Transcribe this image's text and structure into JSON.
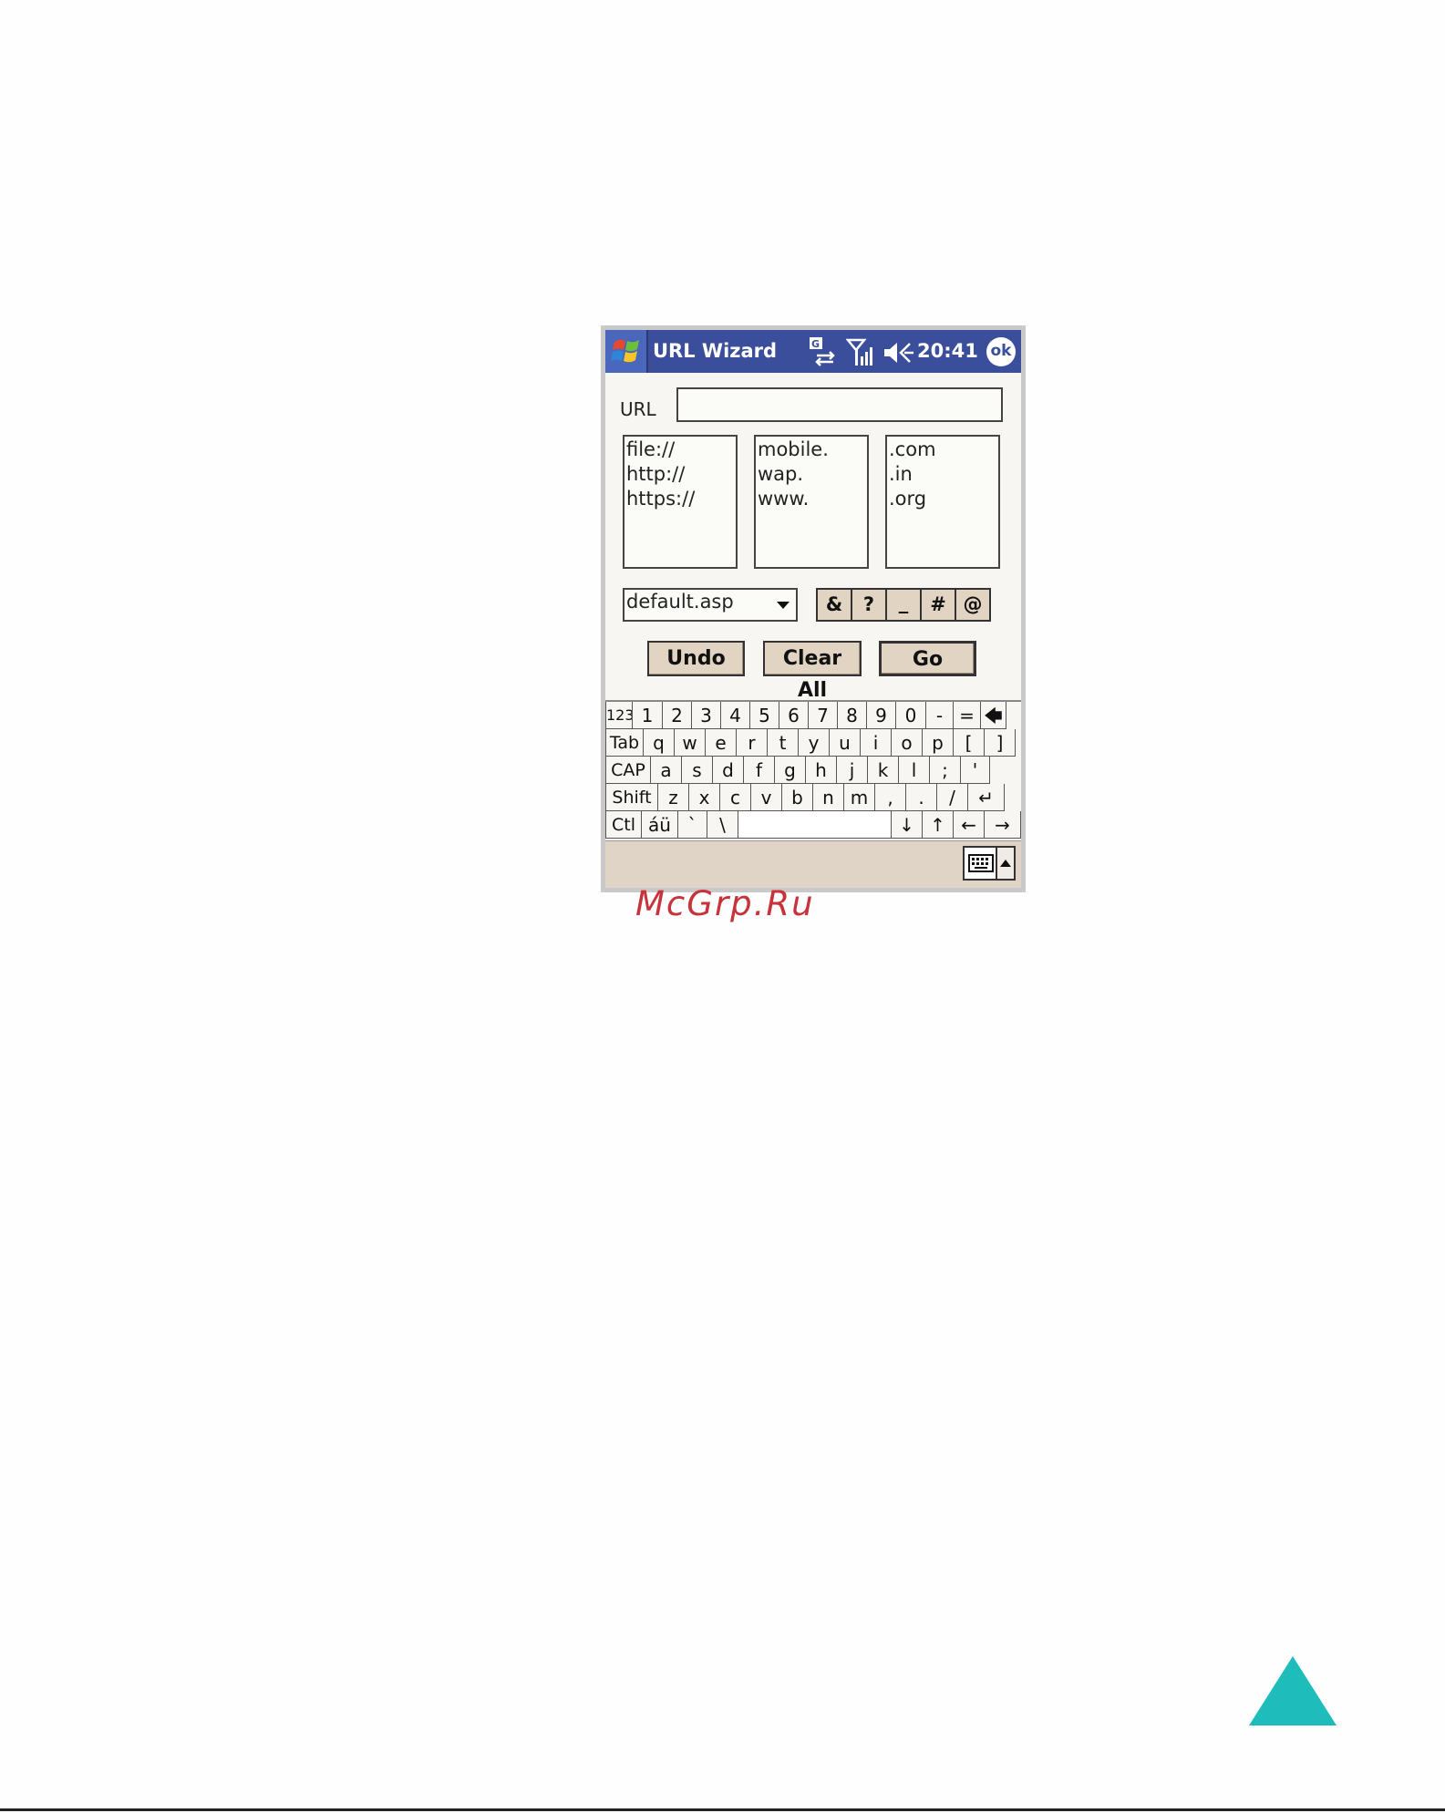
{
  "window": {
    "title": "URL Wizard",
    "clock": "20:41",
    "ok_label": "ok"
  },
  "form": {
    "url_label": "URL",
    "url_value": "",
    "protocols": [
      "file://",
      "http://",
      "https://"
    ],
    "prefixes": [
      "mobile.",
      "wap.",
      "www."
    ],
    "suffixes": [
      ".com",
      ".in",
      ".org"
    ],
    "page_select": "default.asp",
    "symbols": [
      "&",
      "?",
      "_",
      "#",
      "@"
    ],
    "buttons": {
      "undo": "Undo",
      "clear_all": "Clear All",
      "go": "Go"
    }
  },
  "keyboard": {
    "row1": [
      "123",
      "1",
      "2",
      "3",
      "4",
      "5",
      "6",
      "7",
      "8",
      "9",
      "0",
      "-",
      "=",
      "🡄"
    ],
    "row2": [
      "Tab",
      "q",
      "w",
      "e",
      "r",
      "t",
      "y",
      "u",
      "i",
      "o",
      "p",
      "[",
      "]"
    ],
    "row3": [
      "CAP",
      "a",
      "s",
      "d",
      "f",
      "g",
      "h",
      "j",
      "k",
      "l",
      ";",
      "'"
    ],
    "row4": [
      "Shift",
      "z",
      "x",
      "c",
      "v",
      "b",
      "n",
      "m",
      ",",
      ".",
      "/",
      "↵"
    ],
    "row5": [
      "Ctl",
      "áü",
      "`",
      "\\",
      "",
      "↓",
      "↑",
      "←",
      "→"
    ]
  },
  "watermark": "McGrp.Ru",
  "colors": {
    "titlebar": "#3a4e9c",
    "button_face": "#e2d4c2",
    "watermark": "#c8323a",
    "nav_triangle": "#1fbcbc"
  },
  "icons": {
    "start": "windows-flag-icon",
    "status": [
      "data-connection-icon",
      "signal-strength-icon",
      "speaker-icon"
    ],
    "next_page": "triangle-up-icon"
  }
}
